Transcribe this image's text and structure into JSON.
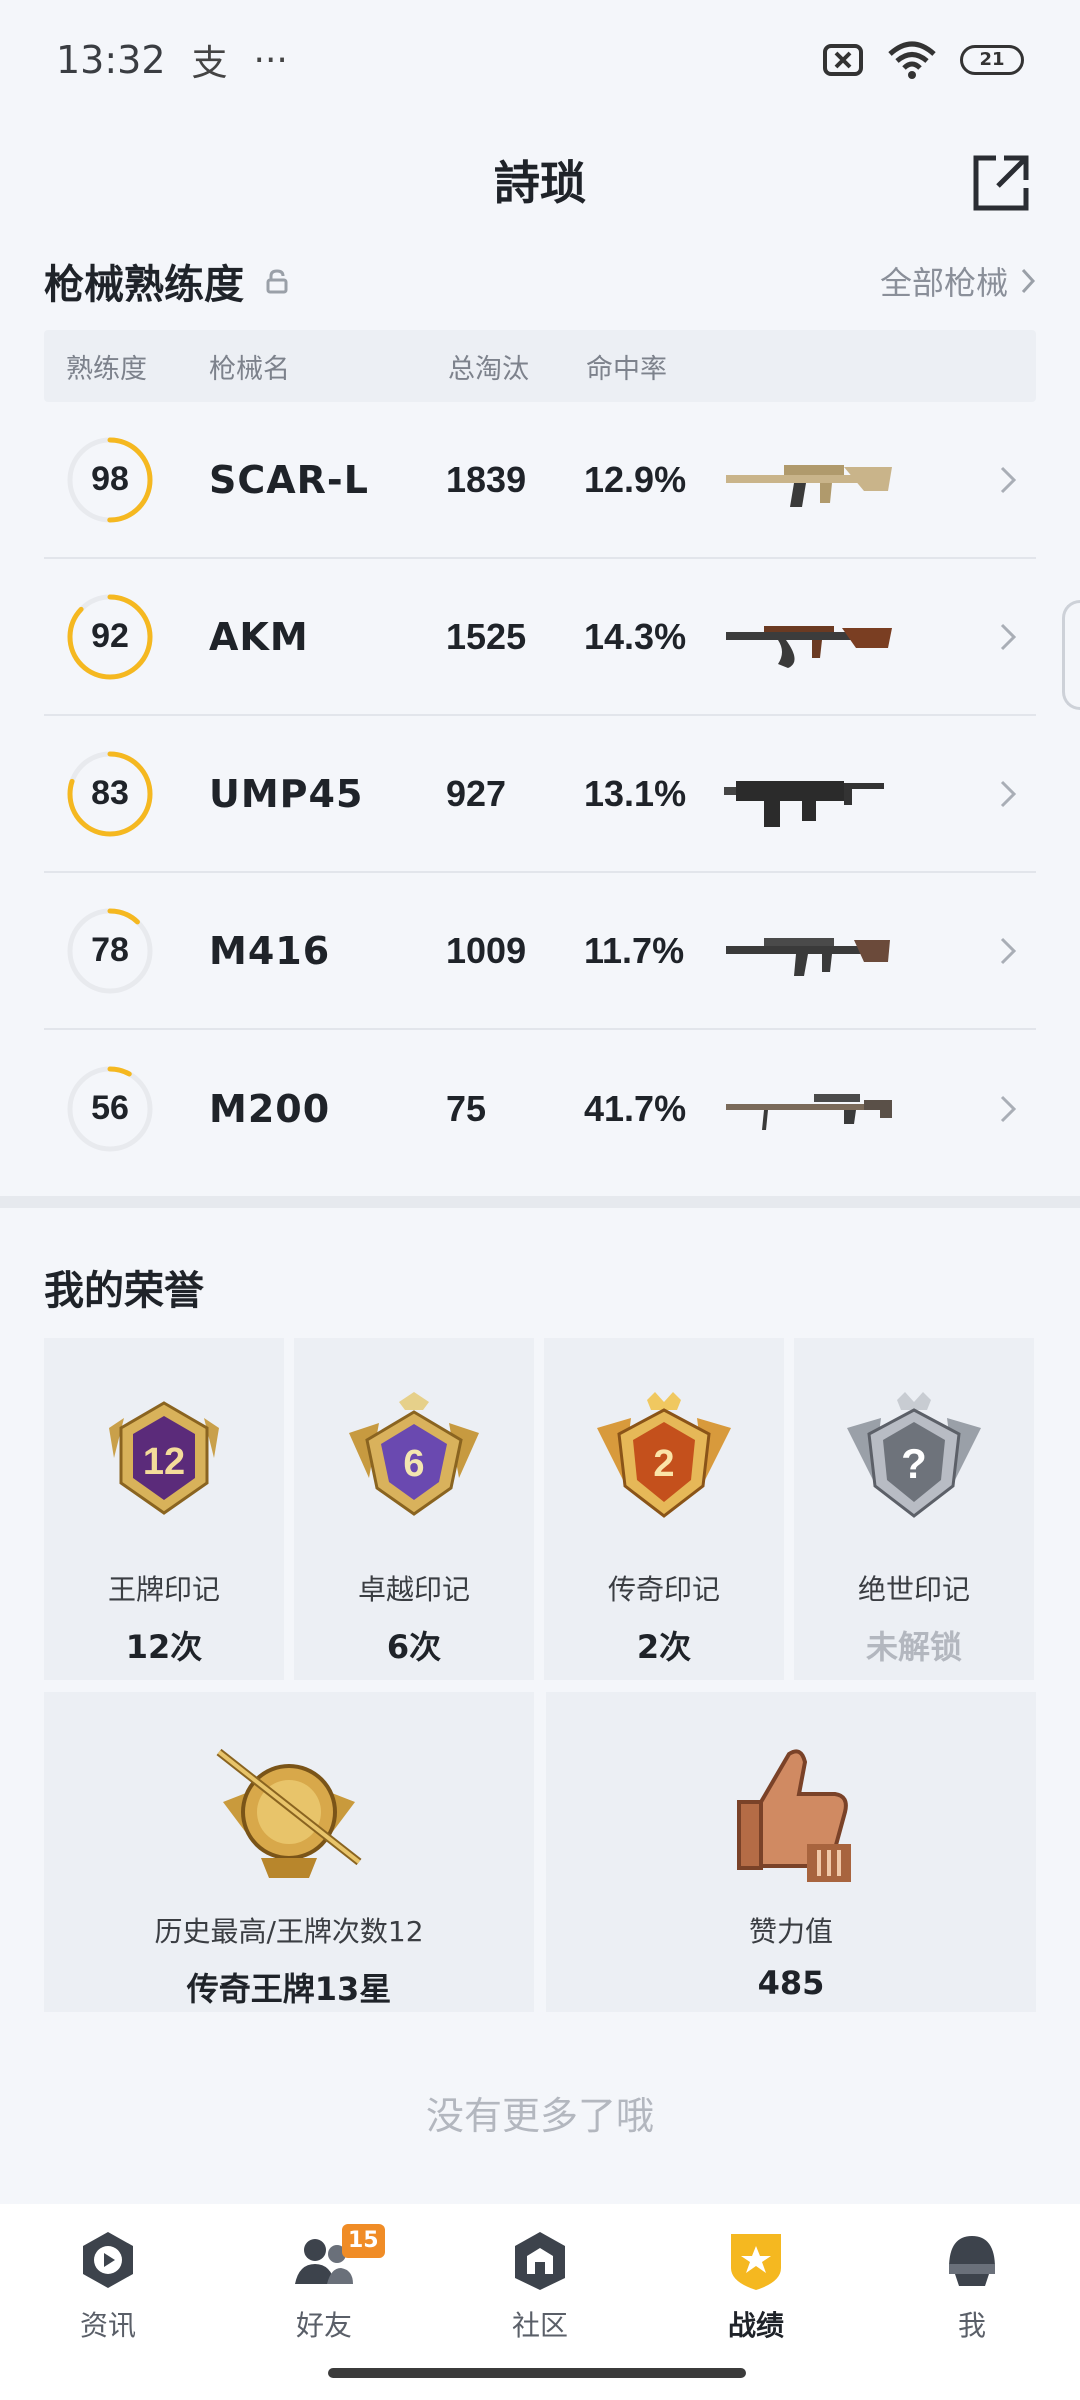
{
  "status_bar": {
    "time": "13:32",
    "extra_glyph": "支",
    "more": "···",
    "battery": "21"
  },
  "header": {
    "title": "詩琐"
  },
  "mastery": {
    "title": "枪械熟练度",
    "all_link": "全部枪械",
    "columns": [
      "熟练度",
      "枪械名",
      "总淘汰",
      "命中率"
    ],
    "rows": [
      {
        "level": "98",
        "level_pct": 0.5,
        "name": "SCAR-L",
        "kills": "1839",
        "accuracy": "12.9%",
        "gun_icon": "scar-l-rifle-icon"
      },
      {
        "level": "92",
        "level_pct": 0.87,
        "name": "AKM",
        "kills": "1525",
        "accuracy": "14.3%",
        "gun_icon": "akm-rifle-icon"
      },
      {
        "level": "83",
        "level_pct": 0.8,
        "name": "UMP45",
        "kills": "927",
        "accuracy": "13.1%",
        "gun_icon": "ump45-smg-icon"
      },
      {
        "level": "78",
        "level_pct": 0.12,
        "name": "M416",
        "kills": "1009",
        "accuracy": "11.7%",
        "gun_icon": "m416-rifle-icon"
      },
      {
        "level": "56",
        "level_pct": 0.08,
        "name": "M200",
        "kills": "75",
        "accuracy": "41.7%",
        "gun_icon": "m200-sniper-icon"
      }
    ]
  },
  "honor": {
    "title": "我的荣誉",
    "cards": [
      {
        "label": "王牌印记",
        "count": "12次",
        "badge_num": "12",
        "icon": "ace-emblem-icon"
      },
      {
        "label": "卓越印记",
        "count": "6次",
        "badge_num": "6",
        "icon": "excellence-emblem-icon"
      },
      {
        "label": "传奇印记",
        "count": "2次",
        "badge_num": "2",
        "icon": "legend-emblem-icon"
      },
      {
        "label": "绝世印记",
        "count": "未解锁",
        "badge_num": "?",
        "icon": "peerless-emblem-icon"
      }
    ],
    "wide": [
      {
        "label": "历史最高/王牌次数12",
        "value": "传奇王牌13星",
        "icon": "legend-ace-rank-icon"
      },
      {
        "label": "赞力值",
        "value": "485",
        "icon": "thumbs-up-icon"
      }
    ]
  },
  "end_text": "没有更多了哦",
  "nav": {
    "items": [
      {
        "label": "资讯",
        "icon": "news-icon"
      },
      {
        "label": "好友",
        "icon": "friends-icon",
        "badge": "15"
      },
      {
        "label": "社区",
        "icon": "community-icon"
      },
      {
        "label": "战绩",
        "icon": "record-icon",
        "active": true
      },
      {
        "label": "我",
        "icon": "profile-icon"
      }
    ]
  },
  "colors": {
    "accent": "#f5b820",
    "background": "#f4f6fa",
    "card": "#eceff4",
    "badge": "#f08c26"
  }
}
